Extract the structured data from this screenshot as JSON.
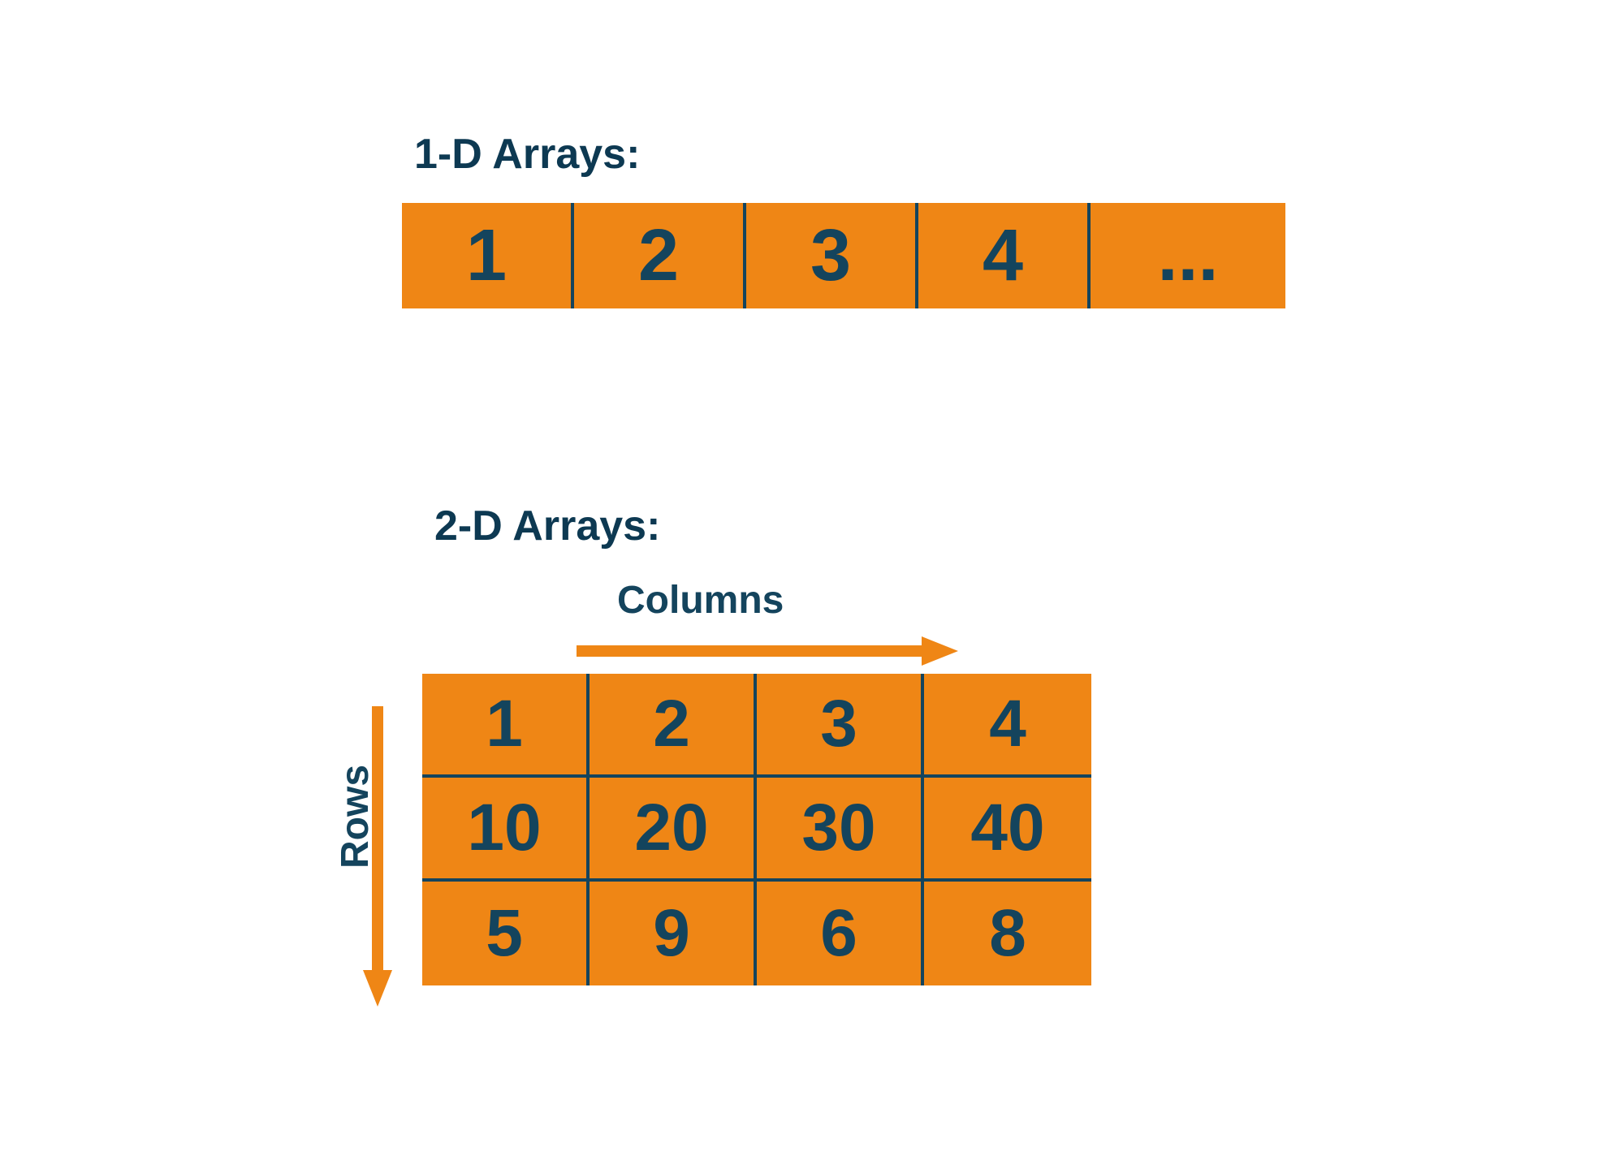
{
  "colors": {
    "cell_bg": "#ef8615",
    "text_dark": "#14445d",
    "title": "#0d3952",
    "arrow": "#ef8615"
  },
  "section_1d": {
    "title": "1-D Arrays:",
    "cells": [
      "1",
      "2",
      "3",
      "4",
      "..."
    ]
  },
  "section_2d": {
    "title": "2-D Arrays:",
    "columns_label": "Columns",
    "rows_label": "Rows",
    "grid": [
      [
        "1",
        "2",
        "3",
        "4"
      ],
      [
        "10",
        "20",
        "30",
        "40"
      ],
      [
        "5",
        "9",
        "6",
        "8"
      ]
    ]
  }
}
